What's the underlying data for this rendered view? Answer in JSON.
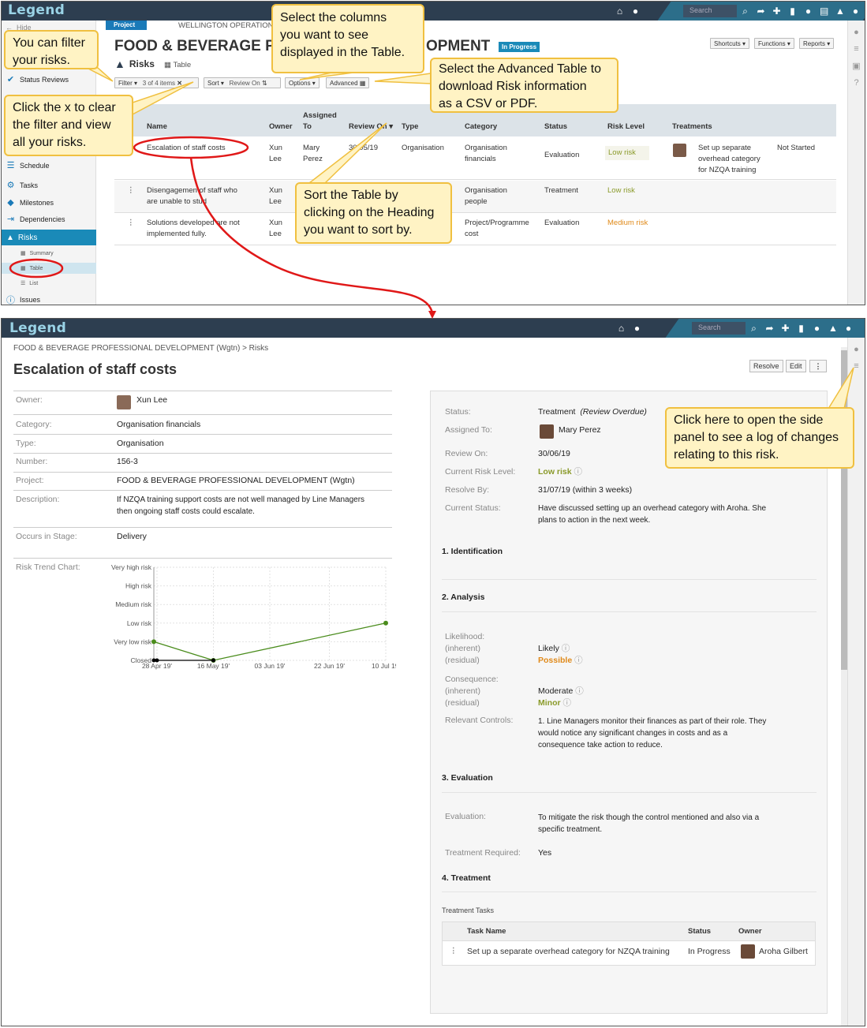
{
  "app": {
    "logo": "Legend",
    "search_placeholder": "Search"
  },
  "top": {
    "hide_label": "Hide",
    "project_tab": "Project",
    "breadcrumb": "WELLINGTON OPERATION",
    "title": "FOOD & BEVERAGE P",
    "title_end": "OPMENT",
    "status_badge": "In Progress",
    "shortcuts": "Shortcuts",
    "functions": "Functions",
    "reports": "Reports",
    "risks_heading": "Risks",
    "table_label": "Table",
    "toolbar": {
      "filter": "Filter",
      "filter_count": "3 of 4 items",
      "sort": "Sort",
      "sort_value": "Review On",
      "options": "Options",
      "advanced": "Advanced"
    },
    "sidebar": {
      "status_reviews": "Status Reviews",
      "schedule": "Schedule",
      "tasks": "Tasks",
      "milestones": "Milestones",
      "dependencies": "Dependencies",
      "risks": "Risks",
      "summary": "Summary",
      "table": "Table",
      "list": "List",
      "issues": "Issues"
    },
    "table": {
      "headers": {
        "name": "Name",
        "owner": "Owner",
        "assigned": "Assigned",
        "assigned_to": "To",
        "review_on": "Review On",
        "type": "Type",
        "category": "Category",
        "status": "Status",
        "risk_level": "Risk Level",
        "treatments": "Treatments"
      },
      "rows": [
        {
          "name": "Escalation of staff costs",
          "owner1": "Xun",
          "owner2": "Lee",
          "assigned1": "Mary",
          "assigned2": "Perez",
          "review": "30/05/19",
          "type": "Organisation",
          "cat1": "Organisation",
          "cat2": "financials",
          "status": "Evaluation",
          "risk": "Low risk",
          "treat1": "Set up separate",
          "treat2": "overhead category",
          "treat3": "for NZQA training",
          "treat_status": "Not Started"
        },
        {
          "name1": "Disengagemen",
          "name1b": "of staff who",
          "name2": "are unable to stud",
          "owner1": "Xun",
          "owner2": "Lee",
          "cat1": "Organisation",
          "cat2": "people",
          "status": "Treatment",
          "risk": "Low risk"
        },
        {
          "name1": "Solutions developed",
          "name1b": "are not",
          "name2": "implemented fully.",
          "owner1": "Xun",
          "owner2": "Lee",
          "cat1": "Project/Programme",
          "cat2": "cost",
          "status": "Evaluation",
          "risk": "Medium risk"
        }
      ]
    }
  },
  "callouts": {
    "filter": [
      "You can filter",
      "your risks."
    ],
    "columns": [
      "Select the columns",
      "you want to see",
      "displayed in the Table."
    ],
    "advanced": [
      "Select the Advanced Table to",
      "download Risk information",
      "as a CSV or PDF."
    ],
    "clear": [
      "Click the x to clear",
      "the filter and view",
      "all your risks."
    ],
    "sort": [
      "Sort the Table by",
      "clicking on the Heading",
      "you want to sort by."
    ],
    "side_panel": [
      "Click here to open the side",
      "panel to see a log of changes",
      "relating to this risk."
    ]
  },
  "detail": {
    "breadcrumb": "FOOD & BEVERAGE PROFESSIONAL DEVELOPMENT (Wgtn) > Risks",
    "title": "Escalation of staff costs",
    "resolve": "Resolve",
    "edit": "Edit",
    "more": "⋮",
    "left": [
      {
        "label": "Owner:",
        "value": "Xun Lee"
      },
      {
        "label": "Category:",
        "value": "Organisation financials"
      },
      {
        "label": "Type:",
        "value": "Organisation"
      },
      {
        "label": "Number:",
        "value": "156-3"
      },
      {
        "label": "Project:",
        "value": "FOOD & BEVERAGE PROFESSIONAL DEVELOPMENT (Wgtn)"
      },
      {
        "label": "Description:",
        "value1": "If NZQA training support costs are not well managed by Line Managers",
        "value2": "then ongoing staff costs could escalate."
      },
      {
        "label": "Occurs in Stage:",
        "value": "Delivery"
      },
      {
        "label": "Risk Trend Chart:"
      }
    ],
    "right": {
      "status_label": "Status:",
      "status": "Treatment",
      "status_note": "(Review Overdue)",
      "assigned_label": "Assigned To:",
      "assigned": "Mary Perez",
      "review_label": "Review On:",
      "review": "30/06/19",
      "crl_label": "Current Risk Level:",
      "crl": "Low risk",
      "resolve_label": "Resolve By:",
      "resolve": "31/07/19 (within 3 weeks)",
      "cs_label": "Current Status:",
      "cs1": "Have discussed setting up an overhead category with Aroha.  She",
      "cs2": "plans to action in the next week.",
      "s1": "1. Identification",
      "s2": "2. Analysis",
      "likelihood": "Likelihood:",
      "inherent": "(inherent)",
      "residual": "(residual)",
      "likely": "Likely",
      "possible": "Possible",
      "consequence": "Consequence:",
      "moderate": "Moderate",
      "minor": "Minor",
      "controls_label": "Relevant Controls:",
      "c1": "1. Line Managers monitor their finances as part of their role. They",
      "c2": "would notice any significant changes in costs and as a",
      "c3": "consequence take action to reduce.",
      "s3": "3. Evaluation",
      "eval_label": "Evaluation:",
      "eval1": "To mitigate the risk though the control mentioned and also via a",
      "eval2": "specific treatment.",
      "treq_label": "Treatment Required:",
      "treq": "Yes",
      "s4": "4. Treatment",
      "tt_label": "Treatment Tasks",
      "tt_headers": {
        "task": "Task Name",
        "status": "Status",
        "owner": "Owner"
      },
      "tt_row": {
        "task": "Set up a separate overhead category for NZQA training",
        "status": "In Progress",
        "owner": "Aroha Gilbert"
      }
    }
  },
  "chart_data": {
    "type": "line",
    "ytick_labels": [
      "Very high risk",
      "High risk",
      "Medium risk",
      "Low risk",
      "Very low risk",
      "Closed"
    ],
    "xtick_labels": [
      "28 Apr 19'",
      "16 May 19'",
      "03 Jun 19'",
      "22 Jun 19'",
      "10 Jul 19'"
    ],
    "series": [
      {
        "color": "#4a8c1c",
        "points": [
          {
            "x": "27 Apr 19",
            "y": "Very low risk"
          },
          {
            "x": "16 May 19",
            "y": "Closed"
          },
          {
            "x": "10 Jul 19",
            "y": "Low risk"
          }
        ]
      },
      {
        "color": "#000000",
        "points": [
          {
            "x": "27 Apr 19",
            "y": "Closed"
          },
          {
            "x": "28 Apr 19",
            "y": "Closed"
          },
          {
            "x": "16 May 19",
            "y": "Closed"
          }
        ]
      }
    ]
  }
}
